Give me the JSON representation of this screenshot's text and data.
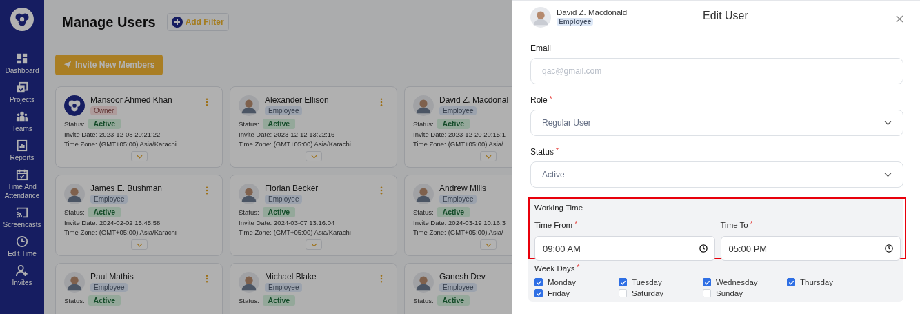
{
  "sidebar": {
    "items": [
      {
        "label": "Dashboard"
      },
      {
        "label": "Projects"
      },
      {
        "label": "Teams"
      },
      {
        "label": "Reports"
      },
      {
        "label": "Time And Attendance"
      },
      {
        "label": "Screencasts"
      },
      {
        "label": "Edit Time"
      },
      {
        "label": "Invites"
      }
    ]
  },
  "header": {
    "title": "Manage Users",
    "add_filter": "Add Filter"
  },
  "invite_button": "Invite New Members",
  "cards": [
    {
      "kind": "owner",
      "name": "Mansoor Ahmed Khan",
      "role": "Owner",
      "status_label": "Status:",
      "status": "Active",
      "invite_label": "Invite Date:",
      "invite_date": "2023-12-08 20:21:22",
      "tz_label": "Time Zone:",
      "time_zone": "(GMT+05:00) Asia/Karachi"
    },
    {
      "kind": "employee",
      "name": "Alexander Ellison",
      "role": "Employee",
      "status_label": "Status:",
      "status": "Active",
      "invite_label": "Invite Date:",
      "invite_date": "2023-12-12 13:22:16",
      "tz_label": "Time Zone:",
      "time_zone": "(GMT+05:00) Asia/Karachi"
    },
    {
      "kind": "employee",
      "name": "David Z. Macdonal",
      "role": "Employee",
      "status_label": "Status:",
      "status": "Active",
      "invite_label": "Invite Date:",
      "invite_date": "2023-12-20 20:15:1",
      "tz_label": "Time Zone:",
      "time_zone": "(GMT+05:00) Asia/"
    },
    {
      "kind": "employee",
      "name": "James E. Bushman",
      "role": "Employee",
      "status_label": "Status:",
      "status": "Active",
      "invite_label": "Invite Date:",
      "invite_date": "2024-02-02 15:45:58",
      "tz_label": "Time Zone:",
      "time_zone": "(GMT+05:00) Asia/Karachi"
    },
    {
      "kind": "employee",
      "name": "Florian Becker",
      "role": "Employee",
      "status_label": "Status:",
      "status": "Active",
      "invite_label": "Invite Date:",
      "invite_date": "2024-03-07 13:16:04",
      "tz_label": "Time Zone:",
      "time_zone": "(GMT+05:00) Asia/Karachi"
    },
    {
      "kind": "employee",
      "name": "Andrew Mills",
      "role": "Employee",
      "status_label": "Status:",
      "status": "Active",
      "invite_label": "Invite Date:",
      "invite_date": "2024-03-19 10:16:3",
      "tz_label": "Time Zone:",
      "time_zone": "(GMT+05:00) Asia/"
    },
    {
      "kind": "employee",
      "name": "Paul Mathis",
      "role": "Employee",
      "status_label": "Status:",
      "status": "Active"
    },
    {
      "kind": "employee",
      "name": "Michael Blake",
      "role": "Employee",
      "status_label": "Status:",
      "status": "Active"
    },
    {
      "kind": "employee",
      "name": "Ganesh Dev",
      "role": "Employee",
      "status_label": "Status:",
      "status": "Active"
    }
  ],
  "panel": {
    "title": "Edit User",
    "user_name": "David Z. Macdonald",
    "user_role": "Employee",
    "email": {
      "label": "Email",
      "placeholder": "qac@gmail.com"
    },
    "role": {
      "label": "Role",
      "required_mark": "*",
      "value": "Regular User"
    },
    "status": {
      "label": "Status",
      "required_mark": "*",
      "value": "Active"
    },
    "working_time": {
      "label": "Working Time",
      "highlighted": true,
      "from": {
        "label": "Time From",
        "required_mark": "*",
        "value": "09:00 AM"
      },
      "to": {
        "label": "Time To",
        "required_mark": "*",
        "value": "05:00 PM"
      }
    },
    "week_days": {
      "label": "Week Days",
      "required_mark": "*",
      "days": [
        {
          "label": "Monday",
          "checked": true
        },
        {
          "label": "Tuesday",
          "checked": true
        },
        {
          "label": "Wednesday",
          "checked": true
        },
        {
          "label": "Thursday",
          "checked": true
        },
        {
          "label": "Friday",
          "checked": true
        },
        {
          "label": "Saturday",
          "checked": false
        },
        {
          "label": "Sunday",
          "checked": false
        }
      ]
    }
  }
}
